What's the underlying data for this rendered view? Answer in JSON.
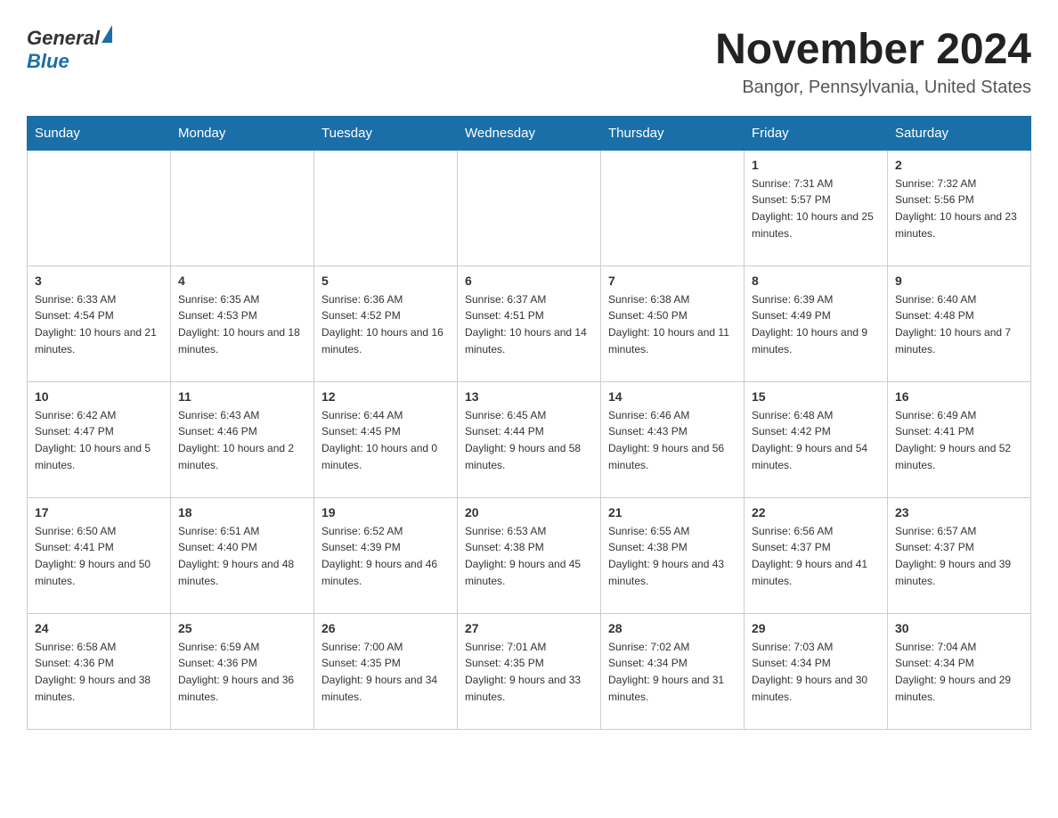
{
  "header": {
    "logo_general": "General",
    "logo_blue": "Blue",
    "month_title": "November 2024",
    "location": "Bangor, Pennsylvania, United States"
  },
  "weekdays": [
    "Sunday",
    "Monday",
    "Tuesday",
    "Wednesday",
    "Thursday",
    "Friday",
    "Saturday"
  ],
  "weeks": [
    [
      {
        "day": "",
        "info": ""
      },
      {
        "day": "",
        "info": ""
      },
      {
        "day": "",
        "info": ""
      },
      {
        "day": "",
        "info": ""
      },
      {
        "day": "",
        "info": ""
      },
      {
        "day": "1",
        "info": "Sunrise: 7:31 AM\nSunset: 5:57 PM\nDaylight: 10 hours and 25 minutes."
      },
      {
        "day": "2",
        "info": "Sunrise: 7:32 AM\nSunset: 5:56 PM\nDaylight: 10 hours and 23 minutes."
      }
    ],
    [
      {
        "day": "3",
        "info": "Sunrise: 6:33 AM\nSunset: 4:54 PM\nDaylight: 10 hours and 21 minutes."
      },
      {
        "day": "4",
        "info": "Sunrise: 6:35 AM\nSunset: 4:53 PM\nDaylight: 10 hours and 18 minutes."
      },
      {
        "day": "5",
        "info": "Sunrise: 6:36 AM\nSunset: 4:52 PM\nDaylight: 10 hours and 16 minutes."
      },
      {
        "day": "6",
        "info": "Sunrise: 6:37 AM\nSunset: 4:51 PM\nDaylight: 10 hours and 14 minutes."
      },
      {
        "day": "7",
        "info": "Sunrise: 6:38 AM\nSunset: 4:50 PM\nDaylight: 10 hours and 11 minutes."
      },
      {
        "day": "8",
        "info": "Sunrise: 6:39 AM\nSunset: 4:49 PM\nDaylight: 10 hours and 9 minutes."
      },
      {
        "day": "9",
        "info": "Sunrise: 6:40 AM\nSunset: 4:48 PM\nDaylight: 10 hours and 7 minutes."
      }
    ],
    [
      {
        "day": "10",
        "info": "Sunrise: 6:42 AM\nSunset: 4:47 PM\nDaylight: 10 hours and 5 minutes."
      },
      {
        "day": "11",
        "info": "Sunrise: 6:43 AM\nSunset: 4:46 PM\nDaylight: 10 hours and 2 minutes."
      },
      {
        "day": "12",
        "info": "Sunrise: 6:44 AM\nSunset: 4:45 PM\nDaylight: 10 hours and 0 minutes."
      },
      {
        "day": "13",
        "info": "Sunrise: 6:45 AM\nSunset: 4:44 PM\nDaylight: 9 hours and 58 minutes."
      },
      {
        "day": "14",
        "info": "Sunrise: 6:46 AM\nSunset: 4:43 PM\nDaylight: 9 hours and 56 minutes."
      },
      {
        "day": "15",
        "info": "Sunrise: 6:48 AM\nSunset: 4:42 PM\nDaylight: 9 hours and 54 minutes."
      },
      {
        "day": "16",
        "info": "Sunrise: 6:49 AM\nSunset: 4:41 PM\nDaylight: 9 hours and 52 minutes."
      }
    ],
    [
      {
        "day": "17",
        "info": "Sunrise: 6:50 AM\nSunset: 4:41 PM\nDaylight: 9 hours and 50 minutes."
      },
      {
        "day": "18",
        "info": "Sunrise: 6:51 AM\nSunset: 4:40 PM\nDaylight: 9 hours and 48 minutes."
      },
      {
        "day": "19",
        "info": "Sunrise: 6:52 AM\nSunset: 4:39 PM\nDaylight: 9 hours and 46 minutes."
      },
      {
        "day": "20",
        "info": "Sunrise: 6:53 AM\nSunset: 4:38 PM\nDaylight: 9 hours and 45 minutes."
      },
      {
        "day": "21",
        "info": "Sunrise: 6:55 AM\nSunset: 4:38 PM\nDaylight: 9 hours and 43 minutes."
      },
      {
        "day": "22",
        "info": "Sunrise: 6:56 AM\nSunset: 4:37 PM\nDaylight: 9 hours and 41 minutes."
      },
      {
        "day": "23",
        "info": "Sunrise: 6:57 AM\nSunset: 4:37 PM\nDaylight: 9 hours and 39 minutes."
      }
    ],
    [
      {
        "day": "24",
        "info": "Sunrise: 6:58 AM\nSunset: 4:36 PM\nDaylight: 9 hours and 38 minutes."
      },
      {
        "day": "25",
        "info": "Sunrise: 6:59 AM\nSunset: 4:36 PM\nDaylight: 9 hours and 36 minutes."
      },
      {
        "day": "26",
        "info": "Sunrise: 7:00 AM\nSunset: 4:35 PM\nDaylight: 9 hours and 34 minutes."
      },
      {
        "day": "27",
        "info": "Sunrise: 7:01 AM\nSunset: 4:35 PM\nDaylight: 9 hours and 33 minutes."
      },
      {
        "day": "28",
        "info": "Sunrise: 7:02 AM\nSunset: 4:34 PM\nDaylight: 9 hours and 31 minutes."
      },
      {
        "day": "29",
        "info": "Sunrise: 7:03 AM\nSunset: 4:34 PM\nDaylight: 9 hours and 30 minutes."
      },
      {
        "day": "30",
        "info": "Sunrise: 7:04 AM\nSunset: 4:34 PM\nDaylight: 9 hours and 29 minutes."
      }
    ]
  ]
}
